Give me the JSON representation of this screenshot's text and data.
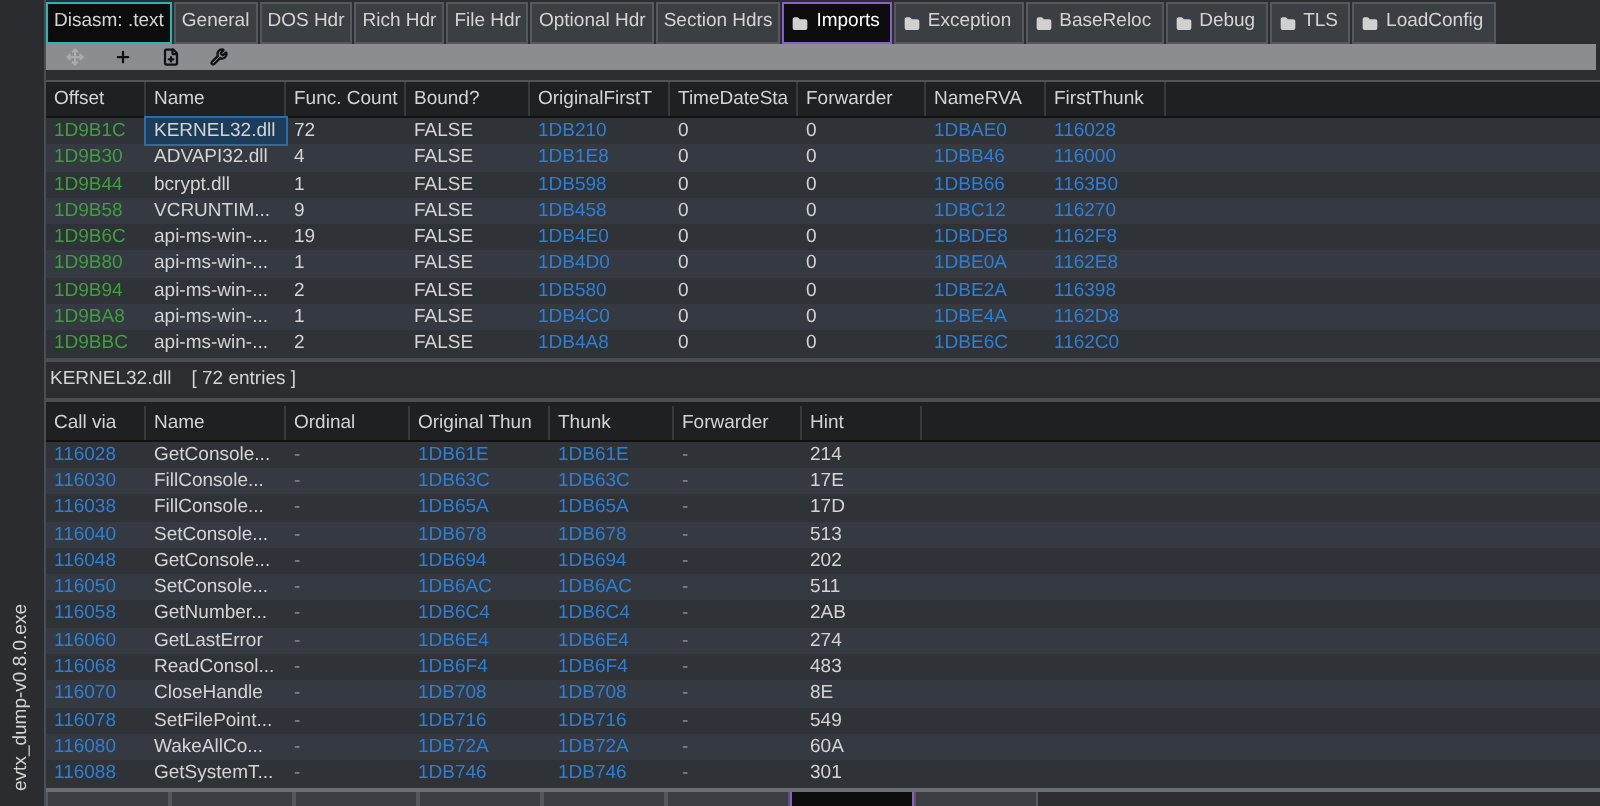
{
  "sidebar": {
    "file_label": "evtx_dump-v0.8.0.exe"
  },
  "tabs": [
    {
      "label": "Disasm: .text",
      "folder": false,
      "highlighted": true,
      "selected": false
    },
    {
      "label": "General",
      "folder": false,
      "highlighted": false,
      "selected": false
    },
    {
      "label": "DOS Hdr",
      "folder": false,
      "highlighted": false,
      "selected": false
    },
    {
      "label": "Rich Hdr",
      "folder": false,
      "highlighted": false,
      "selected": false
    },
    {
      "label": "File Hdr",
      "folder": false,
      "highlighted": false,
      "selected": false
    },
    {
      "label": "Optional Hdr",
      "folder": false,
      "highlighted": false,
      "selected": false
    },
    {
      "label": "Section Hdrs",
      "folder": false,
      "highlighted": false,
      "selected": false
    },
    {
      "label": "Imports",
      "folder": true,
      "highlighted": false,
      "selected": true
    },
    {
      "label": "Exception",
      "folder": true,
      "highlighted": false,
      "selected": false
    },
    {
      "label": "BaseReloc",
      "folder": true,
      "highlighted": false,
      "selected": false
    },
    {
      "label": "Debug",
      "folder": true,
      "highlighted": false,
      "selected": false
    },
    {
      "label": "TLS",
      "folder": true,
      "highlighted": false,
      "selected": false
    },
    {
      "label": "LoadConfig",
      "folder": true,
      "highlighted": false,
      "selected": false
    }
  ],
  "toolbar": [
    {
      "kind": "move",
      "disabled": true
    },
    {
      "kind": "add",
      "disabled": false
    },
    {
      "kind": "file",
      "disabled": false
    },
    {
      "kind": "tool",
      "disabled": false
    }
  ],
  "imports_table": {
    "columns": [
      "Offset",
      "Name",
      "Func. Count",
      "Bound?",
      "OriginalFirstT",
      "TimeDateSta",
      "Forwarder",
      "NameRVA",
      "FirstThunk"
    ],
    "rows": [
      {
        "selected": true,
        "cells": [
          "1D9B1C",
          "KERNEL32.dll",
          "72",
          "FALSE",
          "1DB210",
          "0",
          "0",
          "1DBAE0",
          "116028"
        ]
      },
      {
        "selected": false,
        "cells": [
          "1D9B30",
          "ADVAPI32.dll",
          "4",
          "FALSE",
          "1DB1E8",
          "0",
          "0",
          "1DBB46",
          "116000"
        ]
      },
      {
        "selected": false,
        "cells": [
          "1D9B44",
          "bcrypt.dll",
          "1",
          "FALSE",
          "1DB598",
          "0",
          "0",
          "1DBB66",
          "1163B0"
        ]
      },
      {
        "selected": false,
        "cells": [
          "1D9B58",
          "VCRUNTIM...",
          "9",
          "FALSE",
          "1DB458",
          "0",
          "0",
          "1DBC12",
          "116270"
        ]
      },
      {
        "selected": false,
        "cells": [
          "1D9B6C",
          "api-ms-win-...",
          "19",
          "FALSE",
          "1DB4E0",
          "0",
          "0",
          "1DBDE8",
          "1162F8"
        ]
      },
      {
        "selected": false,
        "cells": [
          "1D9B80",
          "api-ms-win-...",
          "1",
          "FALSE",
          "1DB4D0",
          "0",
          "0",
          "1DBE0A",
          "1162E8"
        ]
      },
      {
        "selected": false,
        "cells": [
          "1D9B94",
          "api-ms-win-...",
          "2",
          "FALSE",
          "1DB580",
          "0",
          "0",
          "1DBE2A",
          "116398"
        ]
      },
      {
        "selected": false,
        "cells": [
          "1D9BA8",
          "api-ms-win-...",
          "1",
          "FALSE",
          "1DB4C0",
          "0",
          "0",
          "1DBE4A",
          "1162D8"
        ]
      },
      {
        "selected": false,
        "cells": [
          "1D9BBC",
          "api-ms-win-...",
          "2",
          "FALSE",
          "1DB4A8",
          "0",
          "0",
          "1DBE6C",
          "1162C0"
        ]
      }
    ]
  },
  "detail_label": {
    "name": "KERNEL32.dll",
    "count": "[ 72 entries ]"
  },
  "functions_table": {
    "columns": [
      "Call via",
      "Name",
      "Ordinal",
      "Original Thun",
      "Thunk",
      "Forwarder",
      "Hint"
    ],
    "rows": [
      [
        "116028",
        "GetConsole...",
        "-",
        "1DB61E",
        "1DB61E",
        "-",
        "214"
      ],
      [
        "116030",
        "FillConsole...",
        "-",
        "1DB63C",
        "1DB63C",
        "-",
        "17E"
      ],
      [
        "116038",
        "FillConsole...",
        "-",
        "1DB65A",
        "1DB65A",
        "-",
        "17D"
      ],
      [
        "116040",
        "SetConsole...",
        "-",
        "1DB678",
        "1DB678",
        "-",
        "513"
      ],
      [
        "116048",
        "GetConsole...",
        "-",
        "1DB694",
        "1DB694",
        "-",
        "202"
      ],
      [
        "116050",
        "SetConsole...",
        "-",
        "1DB6AC",
        "1DB6AC",
        "-",
        "511"
      ],
      [
        "116058",
        "GetNumber...",
        "-",
        "1DB6C4",
        "1DB6C4",
        "-",
        "2AB"
      ],
      [
        "116060",
        "GetLastError",
        "-",
        "1DB6E4",
        "1DB6E4",
        "-",
        "274"
      ],
      [
        "116068",
        "ReadConsol...",
        "-",
        "1DB6F4",
        "1DB6F4",
        "-",
        "483"
      ],
      [
        "116070",
        "CloseHandle",
        "-",
        "1DB708",
        "1DB708",
        "-",
        "8E"
      ],
      [
        "116078",
        "SetFilePoint...",
        "-",
        "1DB716",
        "1DB716",
        "-",
        "549"
      ],
      [
        "116080",
        "WakeAllCo...",
        "-",
        "1DB72A",
        "1DB72A",
        "-",
        "60A"
      ],
      [
        "116088",
        "GetSystemT...",
        "-",
        "1DB746",
        "1DB746",
        "-",
        "301"
      ]
    ]
  },
  "bottom_tabs": [
    {
      "selected": false
    },
    {
      "selected": false
    },
    {
      "selected": false
    },
    {
      "selected": false
    },
    {
      "selected": false
    },
    {
      "selected": false
    },
    {
      "selected": true
    },
    {
      "selected": false
    }
  ]
}
